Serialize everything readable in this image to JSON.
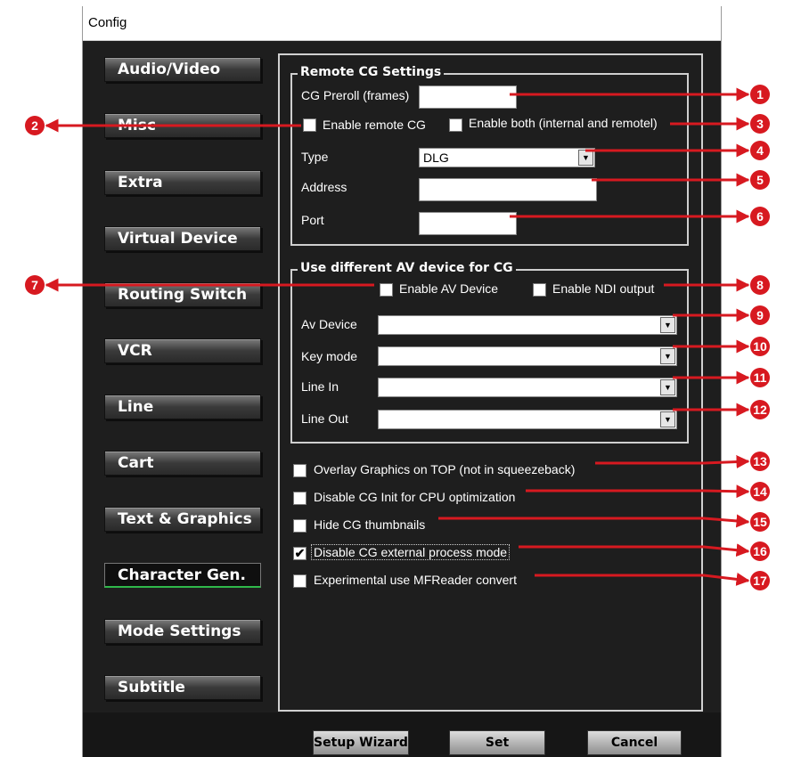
{
  "window": {
    "title": "Config"
  },
  "nav": [
    {
      "label": "Audio/Video"
    },
    {
      "label": "Misc"
    },
    {
      "label": "Extra"
    },
    {
      "label": "Virtual Device"
    },
    {
      "label": "Routing Switch"
    },
    {
      "label": "VCR"
    },
    {
      "label": "Line"
    },
    {
      "label": "Cart"
    },
    {
      "label": "Text & Graphics"
    },
    {
      "label": "Character Gen.",
      "active": true
    },
    {
      "label": "Mode Settings"
    },
    {
      "label": "Subtitle"
    }
  ],
  "remote": {
    "title": "Remote CG Settings",
    "preroll_label": "CG Preroll (frames)",
    "preroll_value": "",
    "enable_remote_label": "Enable remote CG",
    "enable_remote_checked": false,
    "enable_both_label": "Enable both (internal and remotel)",
    "enable_both_checked": false,
    "type_label": "Type",
    "type_value": "DLG",
    "address_label": "Address",
    "address_value": "",
    "port_label": "Port",
    "port_value": ""
  },
  "av": {
    "title": "Use different AV device for CG",
    "enable_av_label": "Enable AV Device",
    "enable_av_checked": false,
    "enable_ndi_label": "Enable NDI output",
    "enable_ndi_checked": false,
    "av_device_label": "Av Device",
    "key_mode_label": "Key mode",
    "line_in_label": "Line In",
    "line_out_label": "Line Out"
  },
  "options": [
    {
      "label": "Overlay Graphics on TOP (not in squeezeback)",
      "checked": false
    },
    {
      "label": "Disable CG Init for CPU optimization",
      "checked": false
    },
    {
      "label": "Hide CG thumbnails",
      "checked": false
    },
    {
      "label": "Disable CG external process mode",
      "checked": true
    },
    {
      "label": "Experimental use MFReader convert",
      "checked": false
    }
  ],
  "footer": {
    "setup_wizard": "Setup Wizard",
    "set": "Set",
    "cancel": "Cancel"
  },
  "callouts": [
    "1",
    "2",
    "3",
    "4",
    "5",
    "6",
    "7",
    "8",
    "9",
    "10",
    "11",
    "12",
    "13",
    "14",
    "15",
    "16",
    "17"
  ],
  "check_mark": "✔",
  "dropdown_arrow": "▼",
  "colors": {
    "callout": "#d71920",
    "active_tab_underline": "#2fb84a",
    "panel_bg": "#1e1e1e"
  }
}
